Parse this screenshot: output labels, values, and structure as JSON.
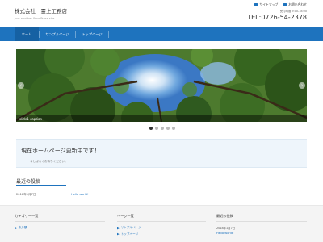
{
  "header": {
    "brand": "株式会社　霊上工務店",
    "tagline": "Just another WordPress site",
    "links": [
      {
        "label": "サイトマップ",
        "icon": "square-icon"
      },
      {
        "label": "お問い合わせ",
        "icon": "mail-icon"
      }
    ],
    "hours": "受付時間 9:00-18:00",
    "phone": "TEL:0726-54-2378"
  },
  "nav": {
    "items": [
      "ホーム",
      "サンプルページ",
      "トップページ"
    ],
    "active_index": 0,
    "color": "#1e73be"
  },
  "slider": {
    "caption": "slide1 caption",
    "dot_count": 5,
    "active_dot": 0
  },
  "notice": {
    "title": "現在ホームページ更新中です！",
    "subtitle": "今しばらくお待ちください。"
  },
  "recent": {
    "heading": "最近の投稿",
    "posts": [
      {
        "date": "2018年1月7日",
        "title": "Hello world!"
      }
    ]
  },
  "footer": {
    "col1": {
      "title": "カテゴリー一覧",
      "items": [
        "未分類"
      ]
    },
    "col2": {
      "title": "ページ一覧",
      "items": [
        "サンプルページ",
        "トップページ"
      ]
    },
    "col3": {
      "title": "最近の投稿",
      "date": "2018年1月7日",
      "link": "Hello world!"
    }
  }
}
